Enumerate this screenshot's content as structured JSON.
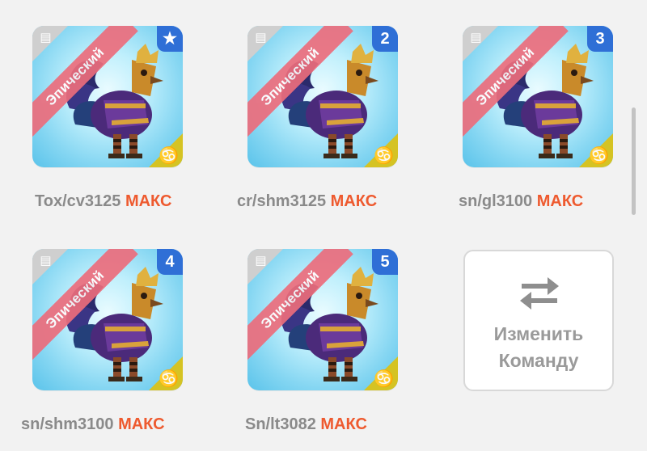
{
  "rarity_label": "Эпический",
  "cards": [
    {
      "badge": "★",
      "name": "Tox/cv3125",
      "level": "МАКС"
    },
    {
      "badge": "2",
      "name": "cr/shm3125",
      "level": "МАКС"
    },
    {
      "badge": "3",
      "name": "sn/gl3100",
      "level": "МАКС"
    },
    {
      "badge": "4",
      "name": "sn/shm3100",
      "level": "МАКС"
    },
    {
      "badge": "5",
      "name": "Sn/lt3082",
      "level": "МАКС"
    }
  ],
  "swap": {
    "line1": "Изменить",
    "line2": "Команду"
  },
  "icons": {
    "calendar": "calendar-icon",
    "zodiac": "♋",
    "swap": "swap-arrows-icon"
  },
  "colors": {
    "ribbon": "#ec6d7c",
    "badge": "#2f6fd6",
    "max": "#ee5a2f",
    "zodiac_corner": "#d5c323"
  }
}
